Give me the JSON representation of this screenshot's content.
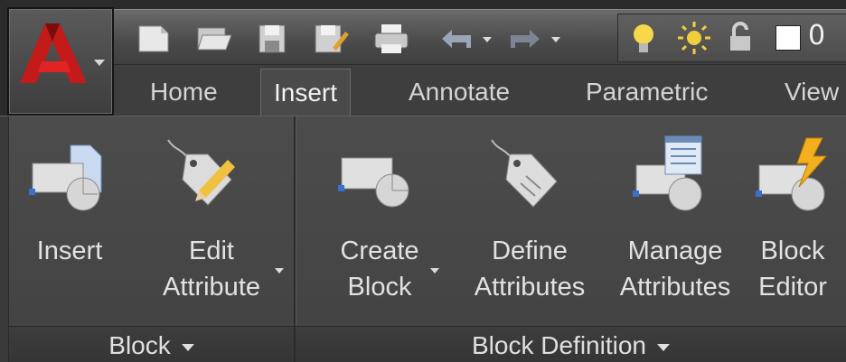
{
  "app_menu": {
    "icon": "autocad-a-logo"
  },
  "quick_access": {
    "icons": [
      "new-icon",
      "open-icon",
      "save-icon",
      "save-as-icon",
      "plot-icon",
      "undo-icon",
      "undo-dropdown-icon",
      "redo-icon",
      "redo-dropdown-icon"
    ],
    "layer_icons": [
      "lightbulb-icon",
      "sun-icon",
      "lock-icon",
      "color-swatch-icon"
    ],
    "layer_value": "0"
  },
  "tabs": [
    {
      "label": "Home",
      "active": false
    },
    {
      "label": "Insert",
      "active": true
    },
    {
      "label": "Annotate",
      "active": false
    },
    {
      "label": "Parametric",
      "active": false
    },
    {
      "label": "View",
      "active": false
    }
  ],
  "panels": {
    "block": {
      "title": "Block",
      "tools": [
        {
          "line1": "Insert",
          "line2": "",
          "icon": "insert-block-icon"
        },
        {
          "line1": "Edit",
          "line2": "Attribute",
          "icon": "edit-attribute-tag-icon"
        }
      ]
    },
    "block_definition": {
      "title": "Block Definition",
      "tools": [
        {
          "line1": "Create",
          "line2": "Block",
          "icon": "create-block-icon"
        },
        {
          "line1": "Define",
          "line2": "Attributes",
          "icon": "define-attributes-tag-icon"
        },
        {
          "line1": "Manage",
          "line2": "Attributes",
          "icon": "manage-attributes-icon"
        },
        {
          "line1": "Block",
          "line2": "Editor",
          "icon": "block-editor-icon"
        }
      ]
    }
  }
}
